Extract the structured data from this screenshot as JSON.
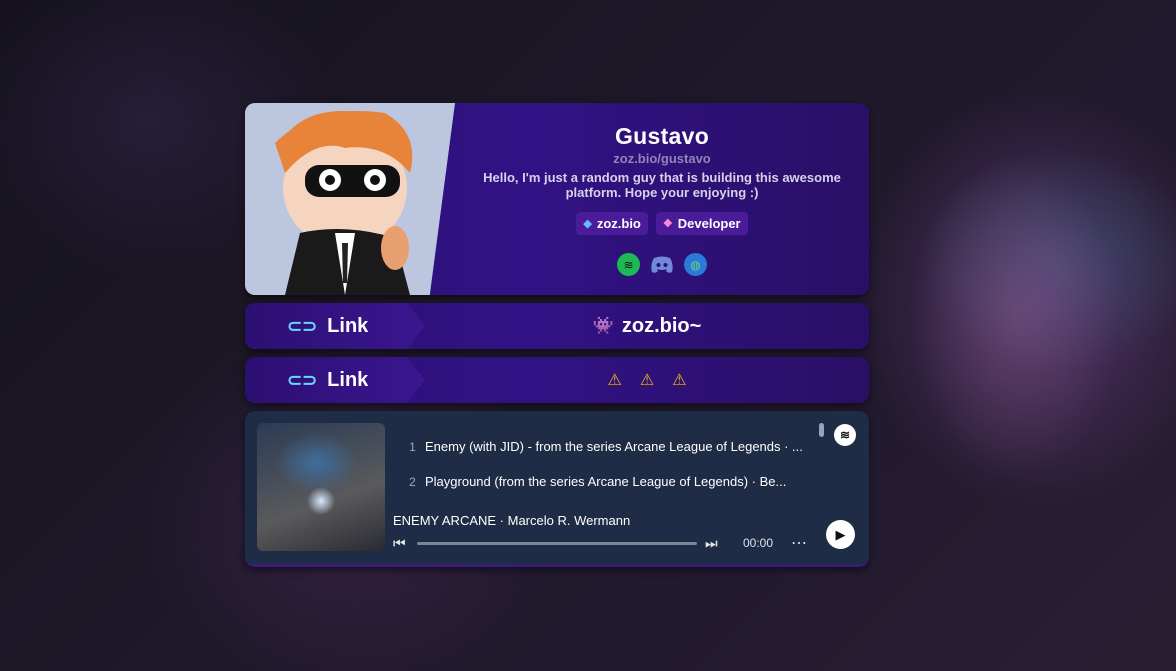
{
  "profile": {
    "name": "Gustavo",
    "handle": "zoz.bio/gustavo",
    "bio": "Hello, I'm just a random guy that is building this awesome platform. Hope your enjoying :)",
    "badges": [
      {
        "label": "zoz.bio",
        "icon": "diamond-icon"
      },
      {
        "label": "Developer",
        "icon": "gem-icon"
      }
    ],
    "socials": [
      "spotify-icon",
      "discord-icon",
      "globe-icon"
    ]
  },
  "links": [
    {
      "label": "Link",
      "title": "zoz.bio~",
      "icon": "alien-icon"
    },
    {
      "label": "Link",
      "title": "",
      "warnings": [
        "⚠",
        "⚠",
        "⚠"
      ]
    }
  ],
  "player": {
    "tracks": [
      {
        "num": "1",
        "title": "Enemy (with JID) - from the series Arcane League of Legends · ..."
      },
      {
        "num": "2",
        "title": "Playground (from the series Arcane League of Legends) · Be..."
      }
    ],
    "now_playing": "ENEMY ARCANE · Marcelo R. Wermann",
    "time": "00:00",
    "progress": 0
  },
  "colors": {
    "card": "#2a1070",
    "badge": "#4a1c9a",
    "player": "#1e2d45",
    "spotify": "#1db954",
    "warning": "#f5b400"
  }
}
